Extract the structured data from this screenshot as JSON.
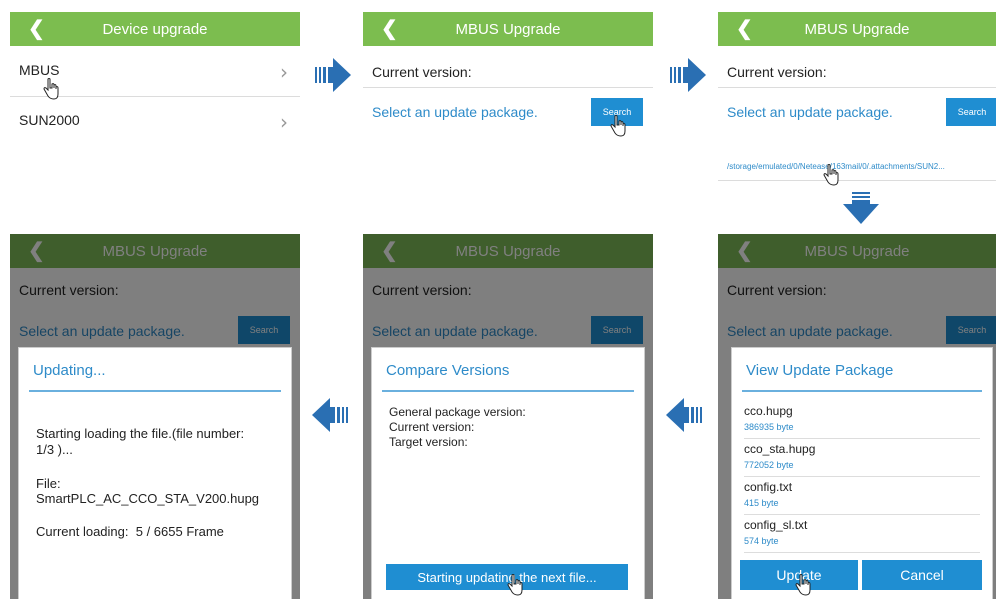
{
  "panel1": {
    "title": "Device upgrade",
    "items": [
      {
        "label": "MBUS"
      },
      {
        "label": "SUN2000"
      }
    ]
  },
  "panel2": {
    "title": "MBUS Upgrade",
    "current_version_label": "Current version:",
    "select_label": "Select an update package.",
    "search_button": "Search"
  },
  "panel3": {
    "title": "MBUS Upgrade",
    "current_version_label": "Current version:",
    "select_label": "Select an update package.",
    "search_button": "Search",
    "path": "/storage/emulated/0/Netease/163mail/0/.attachments/SUN2..."
  },
  "panel4": {
    "title": "MBUS Upgrade",
    "current_version_label": "Current version:",
    "select_label": "Select an update package.",
    "search_button": "Search",
    "dialog_title": "View Update Package",
    "files": [
      {
        "name": "cco.hupg",
        "size": "386935 byte"
      },
      {
        "name": "cco_sta.hupg",
        "size": "772052 byte"
      },
      {
        "name": "config.txt",
        "size": "415 byte"
      },
      {
        "name": "config_sl.txt",
        "size": "574 byte"
      }
    ],
    "update_button": "Update",
    "cancel_button": "Cancel"
  },
  "panel5": {
    "title": "MBUS Upgrade",
    "current_version_label": "Current version:",
    "select_label": "Select an update package.",
    "search_button": "Search",
    "dialog_title": "Compare Versions",
    "general_label": "General package version:",
    "current_label": "Current version:",
    "target_label": "Target version:",
    "start_button": "Starting updating the next file..."
  },
  "panel6": {
    "title": "MBUS Upgrade",
    "current_version_label": "Current version:",
    "select_label": "Select an update package.",
    "search_button": "Search",
    "dialog_title": "Updating...",
    "line1": "Starting loading the file.(file number:",
    "line2": "1/3 )...",
    "file_label": "File:",
    "file_name": "SmartPLC_AC_CCO_STA_V200.hupg",
    "current_loading": "Current loading:  5 / 6655 Frame"
  },
  "colors": {
    "titlebar": "#7cbd4f",
    "accent": "#1f8ed2",
    "arrow": "#2a6fb3"
  }
}
